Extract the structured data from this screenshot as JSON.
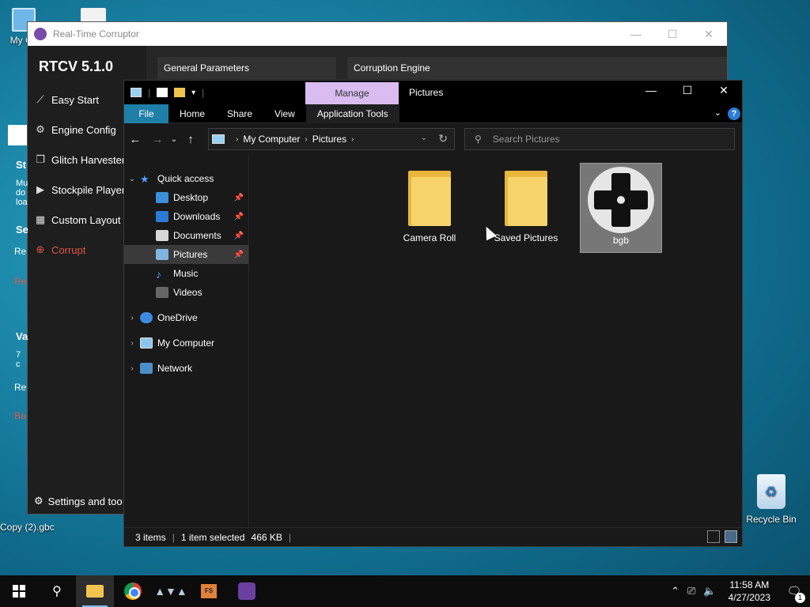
{
  "desktop": {
    "my_computer_label": "My Co",
    "gbc_file_label": "Copy (2).gbc",
    "recycle_bin_label": "Recycle Bin"
  },
  "rtcv": {
    "window_title": "Real-Time Corruptor",
    "brand": "RTCV 5.1.0",
    "menu": [
      {
        "label": "Easy Start",
        "icon": "magic-wand-icon"
      },
      {
        "label": "Engine Config",
        "icon": "gear-icon"
      },
      {
        "label": "Glitch Harvester",
        "icon": "layers-icon"
      },
      {
        "label": "Stockpile Player",
        "icon": "play-icon"
      },
      {
        "label": "Custom Layout",
        "icon": "grid-icon"
      },
      {
        "label": "Corrupt",
        "icon": "target-icon"
      }
    ],
    "settings_label": "Settings and too",
    "panel_general": "General Parameters",
    "panel_engine": "Corruption Engine",
    "partial_left": [
      "St",
      "Mu",
      "do",
      "loa",
      "Se",
      "Re",
      "Re",
      "Va",
      "7 c",
      "Re",
      "Ba"
    ]
  },
  "explorer": {
    "manage_tab": "Manage",
    "window_title": "Pictures",
    "ribbon": {
      "file": "File",
      "home": "Home",
      "share": "Share",
      "view": "View",
      "app_tools": "Application Tools"
    },
    "address": {
      "crumb1": "My Computer",
      "crumb2": "Pictures"
    },
    "search_placeholder": "Search Pictures",
    "tree": {
      "quick_access": "Quick access",
      "desktop": "Desktop",
      "downloads": "Downloads",
      "documents": "Documents",
      "pictures": "Pictures",
      "music": "Music",
      "videos": "Videos",
      "onedrive": "OneDrive",
      "my_computer": "My Computer",
      "network": "Network"
    },
    "items": [
      {
        "name": "Camera Roll"
      },
      {
        "name": "Saved Pictures"
      },
      {
        "name": "bgb"
      }
    ],
    "status": {
      "count": "3 items",
      "selected": "1 item selected",
      "size": "466 KB"
    }
  },
  "taskbar": {
    "time": "11:58 AM",
    "date": "4/27/2023",
    "notifications": "1"
  },
  "colors": {
    "accent_file_tab": "#1e7fa8",
    "manage_tab": "#d9bdf1",
    "corrupt_red": "#e05545"
  }
}
